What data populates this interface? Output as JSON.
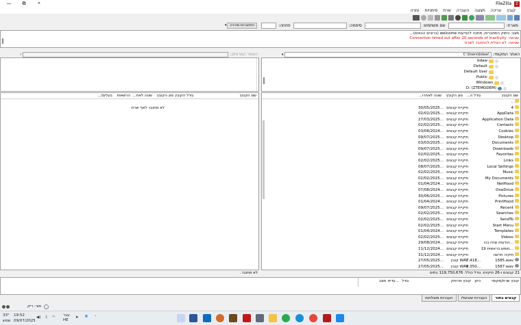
{
  "window": {
    "title": "FileZilla",
    "minimize": "—",
    "restore": "⧉",
    "close": "✕"
  },
  "menu": [
    "קובץ",
    "עריכה",
    "תצוגה",
    "העברה",
    "שרת",
    "סימניות",
    "עזרה"
  ],
  "quickconnect": {
    "host_label": "מארח:",
    "user_label": "שם משתמש:",
    "pass_label": "סיסמה:",
    "port_label": "פתחה:",
    "button": "התחברות מהירה"
  },
  "log": [
    {
      "text": "מצב:      ניתוק התחברות, מחכה להודעות welcome (ברוכים הבאים)...",
      "type": "normal"
    },
    {
      "text": "שגיאה: Connection timed out after 20 seconds of inactivity",
      "type": "error"
    },
    {
      "text": "שגיאה: לא הצליח להתחבר לשרת",
      "type": "error"
    }
  ],
  "local": {
    "path_label": "האתר המקומי:",
    "path": "C:\\Users\\bdaw\\",
    "tree": [
      {
        "name": "bdaw",
        "expander": true
      },
      {
        "name": "Default",
        "expander": true
      },
      {
        "name": "Default User",
        "expander": false
      },
      {
        "name": "Public",
        "expander": true
      },
      {
        "name": "Windows",
        "expander": true
      },
      {
        "name": "D: (ZTEMODEM)",
        "expander": true,
        "drive": true
      }
    ],
    "columns": [
      "שם הקובץ",
      "גודל ה...",
      "סוג הקובץ",
      "שונה לאחרו..."
    ],
    "files": [
      {
        "name": "..",
        "size": "",
        "type": "",
        "modified": ""
      },
      {
        "name": "4",
        "size": "",
        "type": "תיקיית קבצים",
        "modified": "30/05/2025..."
      },
      {
        "name": "AppData",
        "size": "",
        "type": "תיקיית קבצים",
        "modified": "02/02/2025..."
      },
      {
        "name": "Application Data",
        "size": "",
        "type": "תיקיית קבצים",
        "modified": "27/03/2025..."
      },
      {
        "name": "Contacts",
        "size": "",
        "type": "תיקיית קבצים",
        "modified": "02/02/2025..."
      },
      {
        "name": "Cookies",
        "size": "",
        "type": "תיקיית קבצים",
        "modified": "03/08/2024..."
      },
      {
        "name": "Desktop",
        "size": "",
        "type": "תיקיית קבצים",
        "modified": "09/07/2025..."
      },
      {
        "name": "Documents",
        "size": "",
        "type": "תיקיית קבצים",
        "modified": "03/03/2025..."
      },
      {
        "name": "Downloads",
        "size": "",
        "type": "תיקיית קבצים",
        "modified": "09/07/2025..."
      },
      {
        "name": "Favorites",
        "size": "",
        "type": "תיקיית קבצים",
        "modified": "02/02/2025..."
      },
      {
        "name": "Links",
        "size": "",
        "type": "תיקיית קבצים",
        "modified": "02/02/2025..."
      },
      {
        "name": "Local Settings",
        "size": "",
        "type": "תיקיית קבצים",
        "modified": "08/07/2025..."
      },
      {
        "name": "Music",
        "size": "",
        "type": "תיקיית קבצים",
        "modified": "02/02/2025..."
      },
      {
        "name": "My Documents",
        "size": "",
        "type": "תיקיית קבצים",
        "modified": "02/02/2025..."
      },
      {
        "name": "NetHood",
        "size": "",
        "type": "תיקיית קבצים",
        "modified": "01/04/2024..."
      },
      {
        "name": "OneDrive",
        "size": "",
        "type": "תיקיית קבצים",
        "modified": "07/08/2024..."
      },
      {
        "name": "Pictures",
        "size": "",
        "type": "תיקיית קבצים",
        "modified": "30/06/2025..."
      },
      {
        "name": "PrintHood",
        "size": "",
        "type": "תיקיית קבצים",
        "modified": "01/04/2024..."
      },
      {
        "name": "Recent",
        "size": "",
        "type": "תיקיית קבצים",
        "modified": "09/07/2025..."
      },
      {
        "name": "Searches",
        "size": "",
        "type": "תיקיית קבצים",
        "modified": "02/02/2025..."
      },
      {
        "name": "SendTo",
        "size": "",
        "type": "תיקיית קבצים",
        "modified": "02/02/2025..."
      },
      {
        "name": "Start Menu",
        "size": "",
        "type": "תיקיית קבצים",
        "modified": "02/02/2025..."
      },
      {
        "name": "Templates",
        "size": "",
        "type": "תיקיית קבצים",
        "modified": "01/04/2024..."
      },
      {
        "name": "Videos",
        "size": "",
        "type": "תיקיית קבצים",
        "modified": "02/02/2025..."
      },
      {
        "name": "הודעות שהיו בכו...",
        "size": "",
        "type": "תיקיית קבצים",
        "modified": "29/08/2024..."
      },
      {
        "name": "חומש בראשית 19...",
        "size": "",
        "type": "תיקיית קבצים",
        "modified": "11/12/2024..."
      },
      {
        "name": "תיקיה חדשה",
        "size": "",
        "type": "תיקיית קבצים",
        "modified": "31/12/2024..."
      },
      {
        "name": "1585.wav",
        "size": "7,418...",
        "type": "קובץ WAV",
        "modified": "27/05/2025..."
      },
      {
        "name": "1587.wav",
        "size": "9,350...",
        "type": "קובץ WAV",
        "modified": "27/05/2025..."
      }
    ],
    "status": "21 קבצים ו-26 תיקיות. גודל כולל: 119,750,676 בתים"
  },
  "remote": {
    "path_label": "האתר המרוחק:",
    "path": "",
    "columns": [
      "שם הקובץ",
      "גודל הקובץ",
      "סוג הקובץ",
      "שונה לאח...",
      "הרשאות",
      "בעלים/..."
    ],
    "empty_msg": "לא מחובר לאף שרת",
    "status": "לא מחובר."
  },
  "queue": {
    "columns": [
      "קובץ שרת/מקומי",
      "כיוון",
      "קובץ מרוחק",
      "גודל",
      "עדיפ...",
      "מצב"
    ],
    "tabs": [
      {
        "label": "קבצים בתור",
        "active": true
      },
      {
        "label": "העברות שנכשלו",
        "active": false
      },
      {
        "label": "העברות מוצלחות",
        "active": false
      }
    ],
    "status": "תור: ריק"
  },
  "taskbar": {
    "weather_temp": "33°",
    "weather_desc": "שמש",
    "time": "19:52",
    "date": "09/07/2025",
    "lang": "עבר\nHE"
  }
}
